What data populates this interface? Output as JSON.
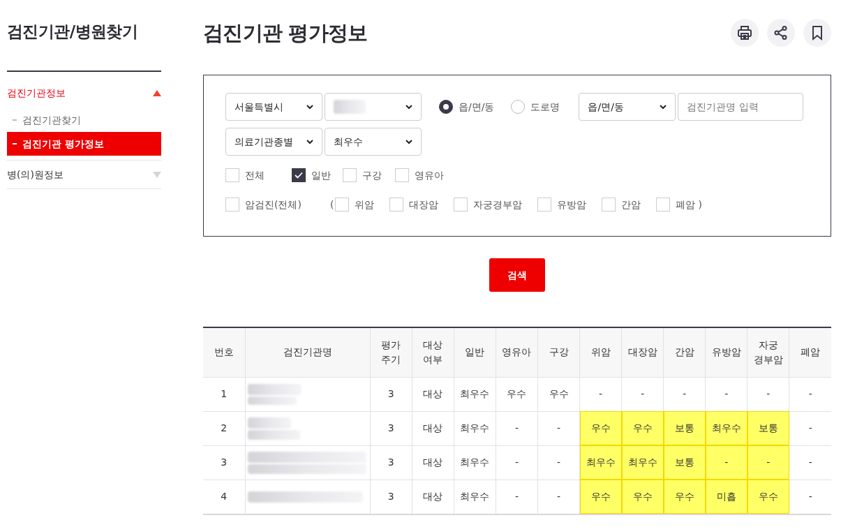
{
  "sidebar": {
    "title": "검진기관/병원찾기",
    "sections": [
      {
        "label": "검진기관정보",
        "expanded": true,
        "children": [
          {
            "label": "검진기관찾기",
            "selected": false
          },
          {
            "label": "검진기관 평가정보",
            "selected": true
          }
        ]
      },
      {
        "label": "병(의)원정보",
        "expanded": false
      }
    ]
  },
  "page_title": "검진기관 평가정보",
  "filters": {
    "region_selects": [
      {
        "value": "서울특별시",
        "redacted": false
      },
      {
        "redacted": true
      }
    ],
    "address_type": [
      {
        "label": "읍/면/동",
        "selected": true
      },
      {
        "label": "도로명",
        "selected": false
      }
    ],
    "address_select": {
      "value": "읍/면/동"
    },
    "name_input": {
      "placeholder": "검진기관명 입력"
    },
    "type_selects": [
      {
        "value": "의료기관종별"
      },
      {
        "value": "최우수"
      }
    ],
    "exam_checkboxes": [
      {
        "label": "전체",
        "checked": false
      },
      {
        "label": "일반",
        "checked": true
      },
      {
        "label": "구강",
        "checked": false
      },
      {
        "label": "영유아",
        "checked": false
      }
    ],
    "cancer_all": {
      "label": "암검진(전체)",
      "checked": false
    },
    "open_paren": "(",
    "cancer_checkboxes": [
      {
        "label": "위암",
        "checked": false
      },
      {
        "label": "대장암",
        "checked": false
      },
      {
        "label": "자궁경부암",
        "checked": false
      },
      {
        "label": "유방암",
        "checked": false
      },
      {
        "label": "간암",
        "checked": false
      },
      {
        "label": "폐암",
        "checked": false
      }
    ],
    "close_paren": ")"
  },
  "search_button": "검색",
  "table": {
    "columns": [
      "번호",
      "검진기관명",
      "평가 주기",
      "대상 여부",
      "일반",
      "영유아",
      "구강",
      "위암",
      "대장암",
      "간암",
      "유방암",
      "자궁 경부암",
      "폐암"
    ],
    "rows": [
      {
        "cells": [
          {
            "text": "1",
            "highlighted": false
          },
          {
            "redacted": true,
            "highlighted": false
          },
          {
            "text": "3",
            "highlighted": false
          },
          {
            "text": "대상",
            "highlighted": false
          },
          {
            "text": "최우수",
            "highlighted": false
          },
          {
            "text": "우수",
            "highlighted": false
          },
          {
            "text": "우수",
            "highlighted": false
          },
          {
            "text": "-",
            "highlighted": false
          },
          {
            "text": "-",
            "highlighted": false
          },
          {
            "text": "-",
            "highlighted": false
          },
          {
            "text": "-",
            "highlighted": false
          },
          {
            "text": "-",
            "highlighted": false
          },
          {
            "text": "-",
            "highlighted": false
          }
        ]
      },
      {
        "cells": [
          {
            "text": "2",
            "highlighted": false
          },
          {
            "redacted": true,
            "highlighted": false
          },
          {
            "text": "3",
            "highlighted": false
          },
          {
            "text": "대상",
            "highlighted": false
          },
          {
            "text": "최우수",
            "highlighted": false
          },
          {
            "text": "-",
            "highlighted": false
          },
          {
            "text": "-",
            "highlighted": false
          },
          {
            "text": "우수",
            "highlighted": true
          },
          {
            "text": "우수",
            "highlighted": true
          },
          {
            "text": "보통",
            "highlighted": true
          },
          {
            "text": "최우수",
            "highlighted": true
          },
          {
            "text": "보통",
            "highlighted": true
          },
          {
            "text": "-",
            "highlighted": false
          }
        ]
      },
      {
        "cells": [
          {
            "text": "3",
            "highlighted": false
          },
          {
            "redacted": true,
            "highlighted": false
          },
          {
            "text": "3",
            "highlighted": false
          },
          {
            "text": "대상",
            "highlighted": false
          },
          {
            "text": "최우수",
            "highlighted": false
          },
          {
            "text": "-",
            "highlighted": false
          },
          {
            "text": "-",
            "highlighted": false
          },
          {
            "text": "최우수",
            "highlighted": true
          },
          {
            "text": "최우수",
            "highlighted": true
          },
          {
            "text": "보통",
            "highlighted": true
          },
          {
            "text": "-",
            "highlighted": true
          },
          {
            "text": "-",
            "highlighted": true
          },
          {
            "text": "-",
            "highlighted": false
          }
        ]
      },
      {
        "cells": [
          {
            "text": "4",
            "highlighted": false
          },
          {
            "redacted": true,
            "highlighted": false
          },
          {
            "text": "3",
            "highlighted": false
          },
          {
            "text": "대상",
            "highlighted": false
          },
          {
            "text": "최우수",
            "highlighted": false
          },
          {
            "text": "-",
            "highlighted": false
          },
          {
            "text": "-",
            "highlighted": false
          },
          {
            "text": "우수",
            "highlighted": true
          },
          {
            "text": "우수",
            "highlighted": true
          },
          {
            "text": "우수",
            "highlighted": true
          },
          {
            "text": "미흡",
            "highlighted": true
          },
          {
            "text": "우수",
            "highlighted": true
          },
          {
            "text": "-",
            "highlighted": false
          }
        ]
      }
    ]
  }
}
